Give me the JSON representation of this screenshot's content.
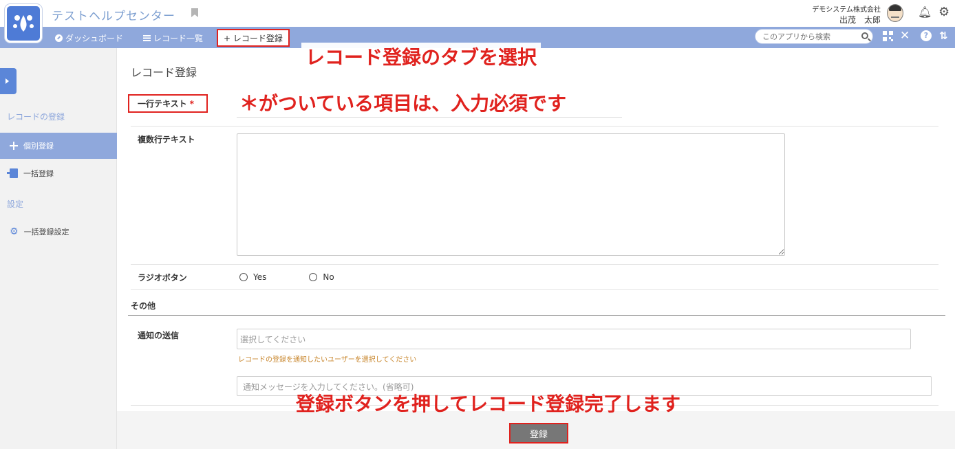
{
  "header": {
    "app_title": "テストヘルプセンター",
    "company": "デモシステム株式会社",
    "user_name": "出茂　太郎"
  },
  "nav": {
    "dashboard": "ダッシュボード",
    "record_list": "レコード一覧",
    "record_add": "+ レコード登録",
    "search_placeholder": "このアプリから検索"
  },
  "sidebar": {
    "section_register": "レコードの登録",
    "item_single": "個別登録",
    "item_bulk": "一括登録",
    "section_settings": "設定",
    "item_bulk_settings": "一括登録設定"
  },
  "form": {
    "page_title": "レコード登録",
    "single_line_label": "一行テキスト",
    "required_mark": "*",
    "multi_line_label": "複数行テキスト",
    "radio_label": "ラジオボタン",
    "radio_options": [
      "Yes",
      "No"
    ],
    "section_other": "その他",
    "notify_label": "通知の送信",
    "notify_select_placeholder": "選択してください",
    "notify_hint": "レコードの登録を通知したいユーザーを選択してください",
    "notify_message_placeholder": "通知メッセージを入力してください。(省略可)"
  },
  "footer": {
    "register_button": "登録"
  },
  "annotations": {
    "tab_note": "レコード登録のタブを選択",
    "required_note": "＊がついている項目は、入力必須です",
    "submit_note": "登録ボタンを押してレコード登録完了します"
  },
  "colors": {
    "accent": "#8fa8dc",
    "annotation": "#e0221e"
  }
}
